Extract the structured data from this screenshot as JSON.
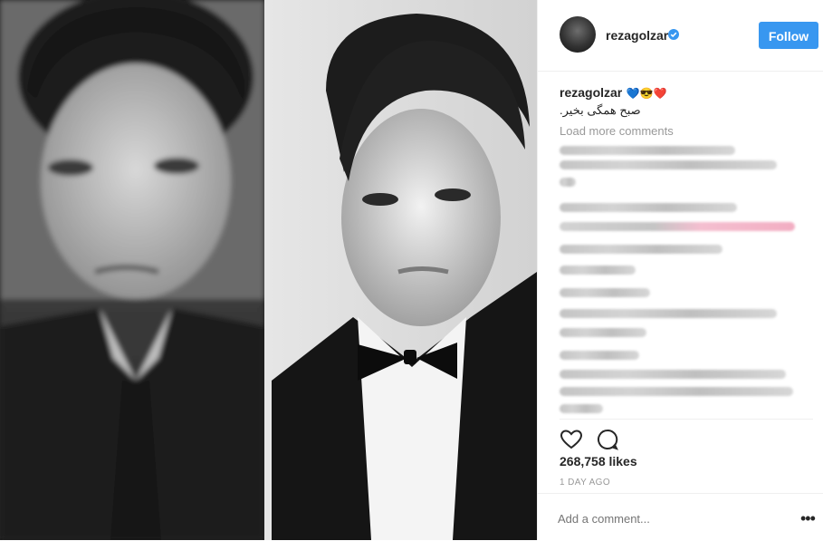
{
  "post": {
    "username": "rezagolzar",
    "follow_label": "Follow",
    "caption_user": "rezagolzar",
    "caption_emojis": "💙😎❤️",
    "caption_text": "صبح همگی بخیر.",
    "load_more_label": "Load more comments",
    "likes": "268,758 likes",
    "time_ago": "1 DAY AGO",
    "comment_placeholder": "Add a comment...",
    "more_options": "•••"
  },
  "colors": {
    "accent": "#3897f0",
    "text": "#262626",
    "muted": "#999999",
    "border": "#efefef"
  },
  "icons": [
    "verified-badge-icon",
    "heart-icon",
    "comment-icon",
    "more-options-icon"
  ]
}
